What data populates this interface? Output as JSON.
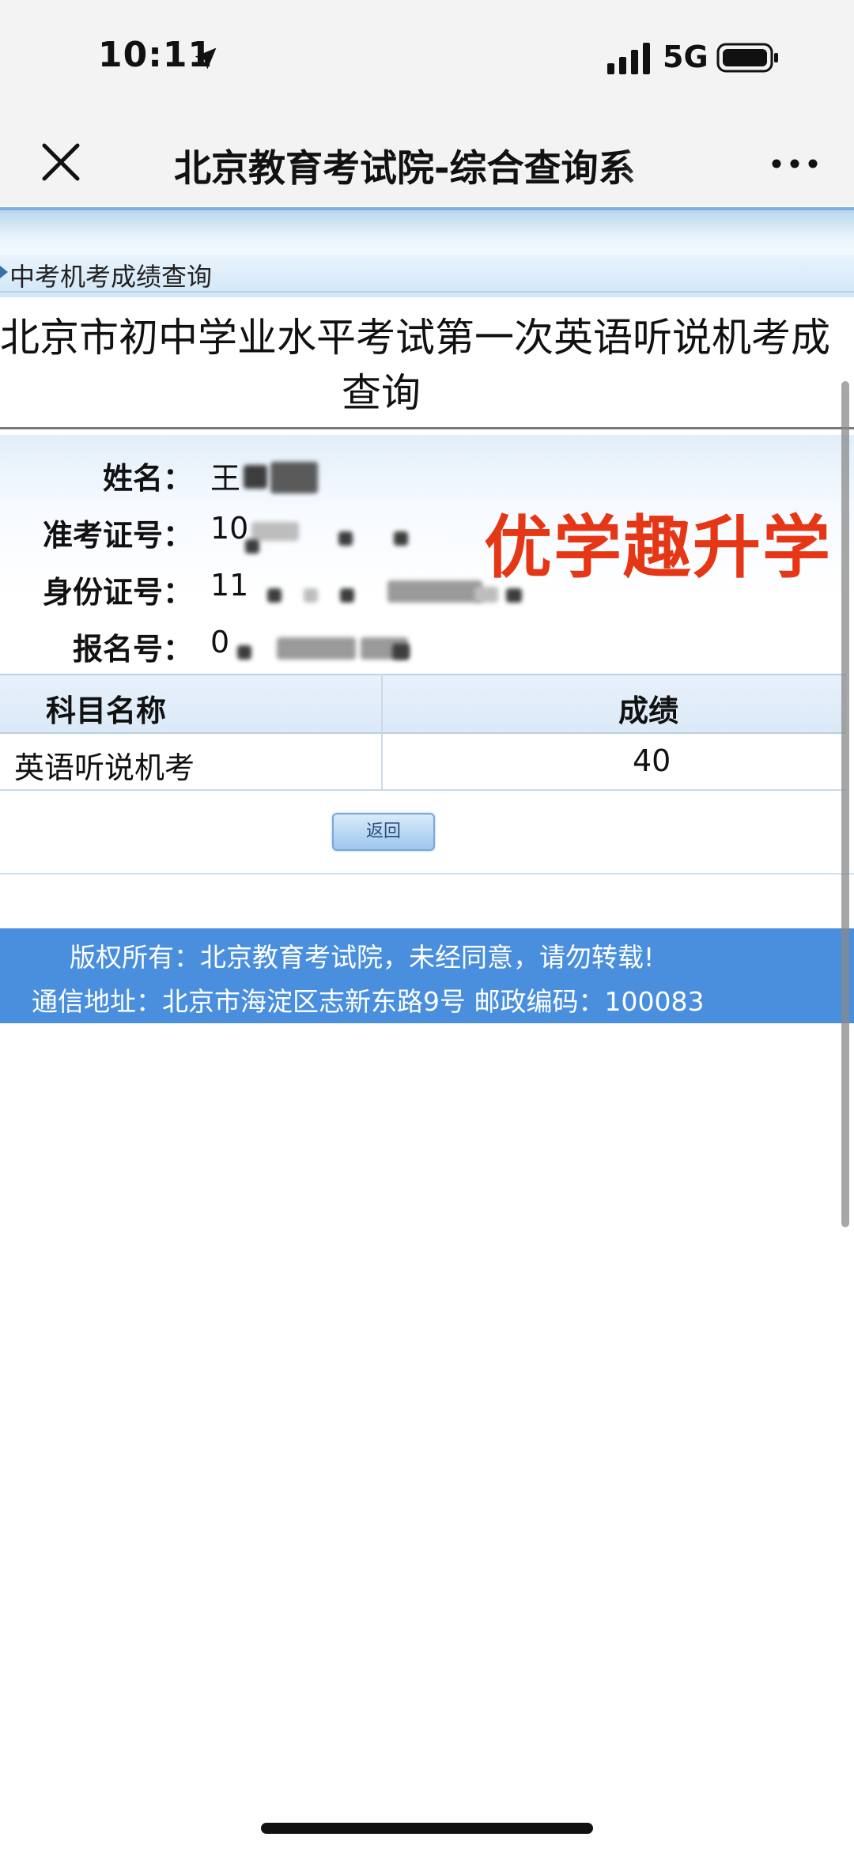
{
  "status_bar": {
    "time": "10:11",
    "network": "5G"
  },
  "nav": {
    "title": "北京教育考试院-综合查询系"
  },
  "breadcrumb": "中考机考成绩查询",
  "page_title_line1": "北京市初中学业水平考试第一次英语听说机考成",
  "page_title_line2": "查询",
  "info": {
    "name_label": "姓名：",
    "name_value": "王",
    "exam_id_label": "准考证号：",
    "exam_id_value": "10",
    "id_card_label": "身份证号：",
    "id_card_value": "11",
    "reg_no_label": "报名号：",
    "reg_no_value": "0"
  },
  "watermark": "优学趣升学",
  "table": {
    "headers": [
      "科目名称",
      "成绩"
    ],
    "rows": [
      {
        "subject": "英语听说机考",
        "score": "40"
      }
    ]
  },
  "back_button": "返回",
  "footer": {
    "line1": "版权所有：北京教育考试院，未经同意，请勿转载!",
    "line2": "通信地址：北京市海淀区志新东路9号 邮政编码：100083"
  }
}
